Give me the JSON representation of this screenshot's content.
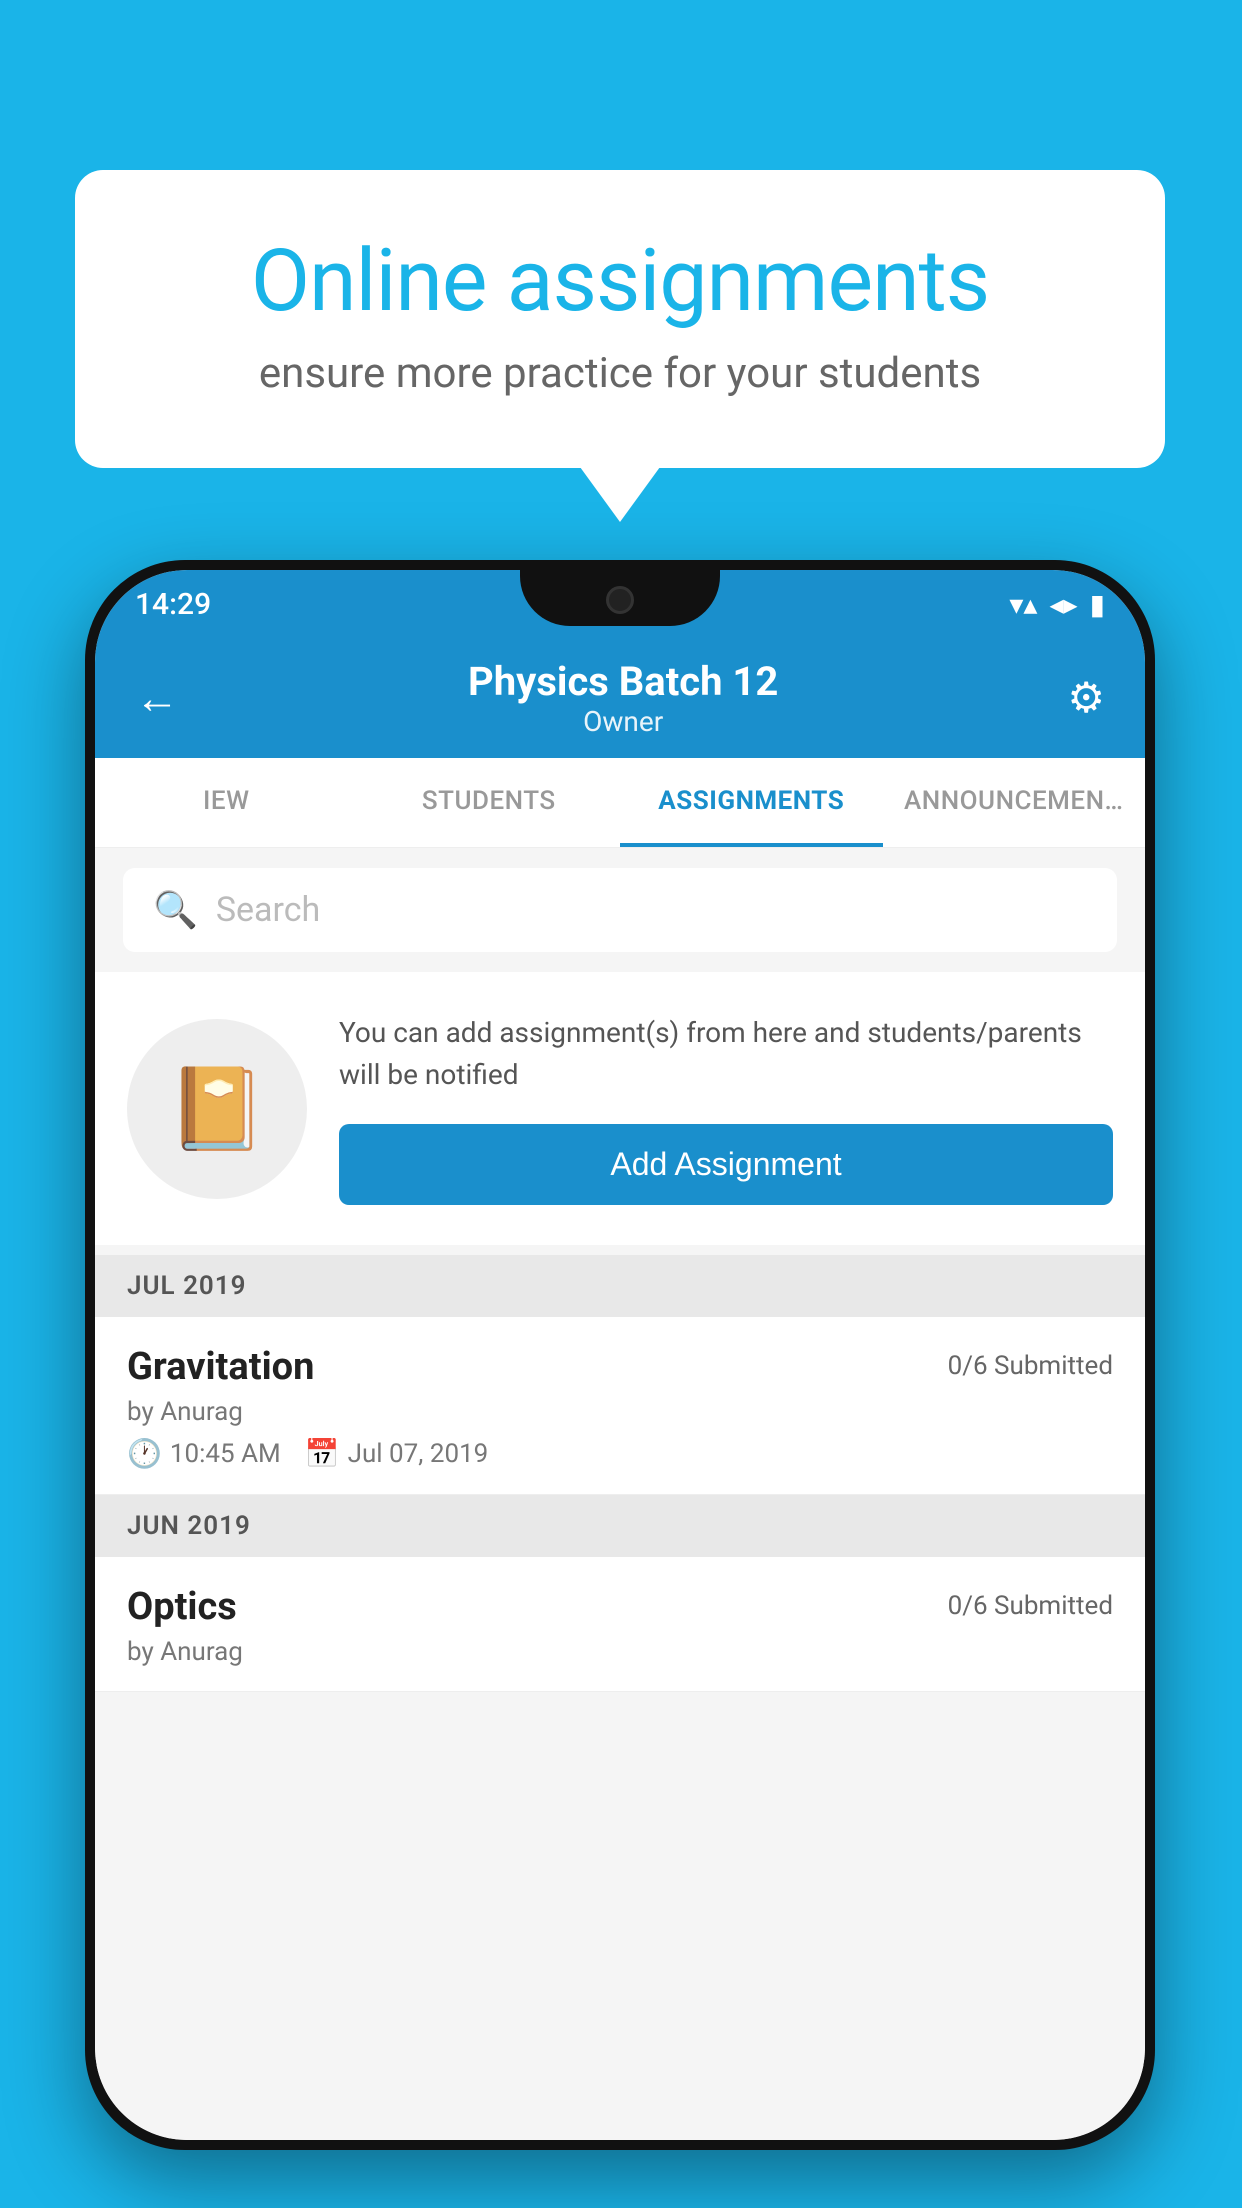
{
  "background_color": "#1ab4e8",
  "bubble": {
    "title": "Online assignments",
    "subtitle": "ensure more practice for your students"
  },
  "status_bar": {
    "time": "14:29",
    "wifi": "▼◀",
    "signal": "◀",
    "battery": "▮"
  },
  "header": {
    "title": "Physics Batch 12",
    "subtitle": "Owner",
    "back_label": "←",
    "settings_label": "⚙"
  },
  "tabs": [
    {
      "label": "IEW",
      "active": false
    },
    {
      "label": "STUDENTS",
      "active": false
    },
    {
      "label": "ASSIGNMENTS",
      "active": true
    },
    {
      "label": "ANNOUNCEMENTS",
      "active": false
    }
  ],
  "search": {
    "placeholder": "Search"
  },
  "empty_state": {
    "description": "You can add assignment(s) from here and students/parents will be notified",
    "button_label": "Add Assignment"
  },
  "sections": [
    {
      "label": "JUL 2019",
      "assignments": [
        {
          "name": "Gravitation",
          "submitted": "0/6 Submitted",
          "author": "by Anurag",
          "time": "10:45 AM",
          "date": "Jul 07, 2019"
        }
      ]
    },
    {
      "label": "JUN 2019",
      "assignments": [
        {
          "name": "Optics",
          "submitted": "0/6 Submitted",
          "author": "by Anurag",
          "time": "",
          "date": ""
        }
      ]
    }
  ]
}
